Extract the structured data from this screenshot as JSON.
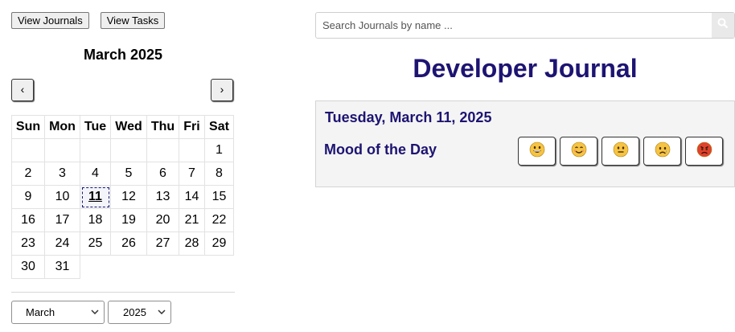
{
  "toolbar": {
    "view_journals": "View Journals",
    "view_tasks": "View Tasks"
  },
  "calendar": {
    "title": "March 2025",
    "prev": "‹",
    "next": "›",
    "weekdays": [
      "Sun",
      "Mon",
      "Tue",
      "Wed",
      "Thu",
      "Fri",
      "Sat"
    ],
    "weeks": [
      [
        "",
        "",
        "",
        "",
        "",
        "",
        "1"
      ],
      [
        "2",
        "3",
        "4",
        "5",
        "6",
        "7",
        "8"
      ],
      [
        "9",
        "10",
        "11",
        "12",
        "13",
        "14",
        "15"
      ],
      [
        "16",
        "17",
        "18",
        "19",
        "20",
        "21",
        "22"
      ],
      [
        "23",
        "24",
        "25",
        "26",
        "27",
        "28",
        "29"
      ],
      [
        "30",
        "31"
      ]
    ],
    "selected_day": "11",
    "month_select": "March",
    "year_select": "2025"
  },
  "search": {
    "placeholder": "Search Journals by name ..."
  },
  "journal": {
    "title": "Developer Journal",
    "date": "Tuesday, March 11, 2025",
    "mood_label": "Mood of the Day",
    "moods": [
      {
        "name": "grinning",
        "color": "#f6c443"
      },
      {
        "name": "smiling",
        "color": "#f6c443"
      },
      {
        "name": "neutral",
        "color": "#f6c443"
      },
      {
        "name": "sad",
        "color": "#f6c443"
      },
      {
        "name": "angry",
        "color": "#e0412c"
      }
    ]
  }
}
